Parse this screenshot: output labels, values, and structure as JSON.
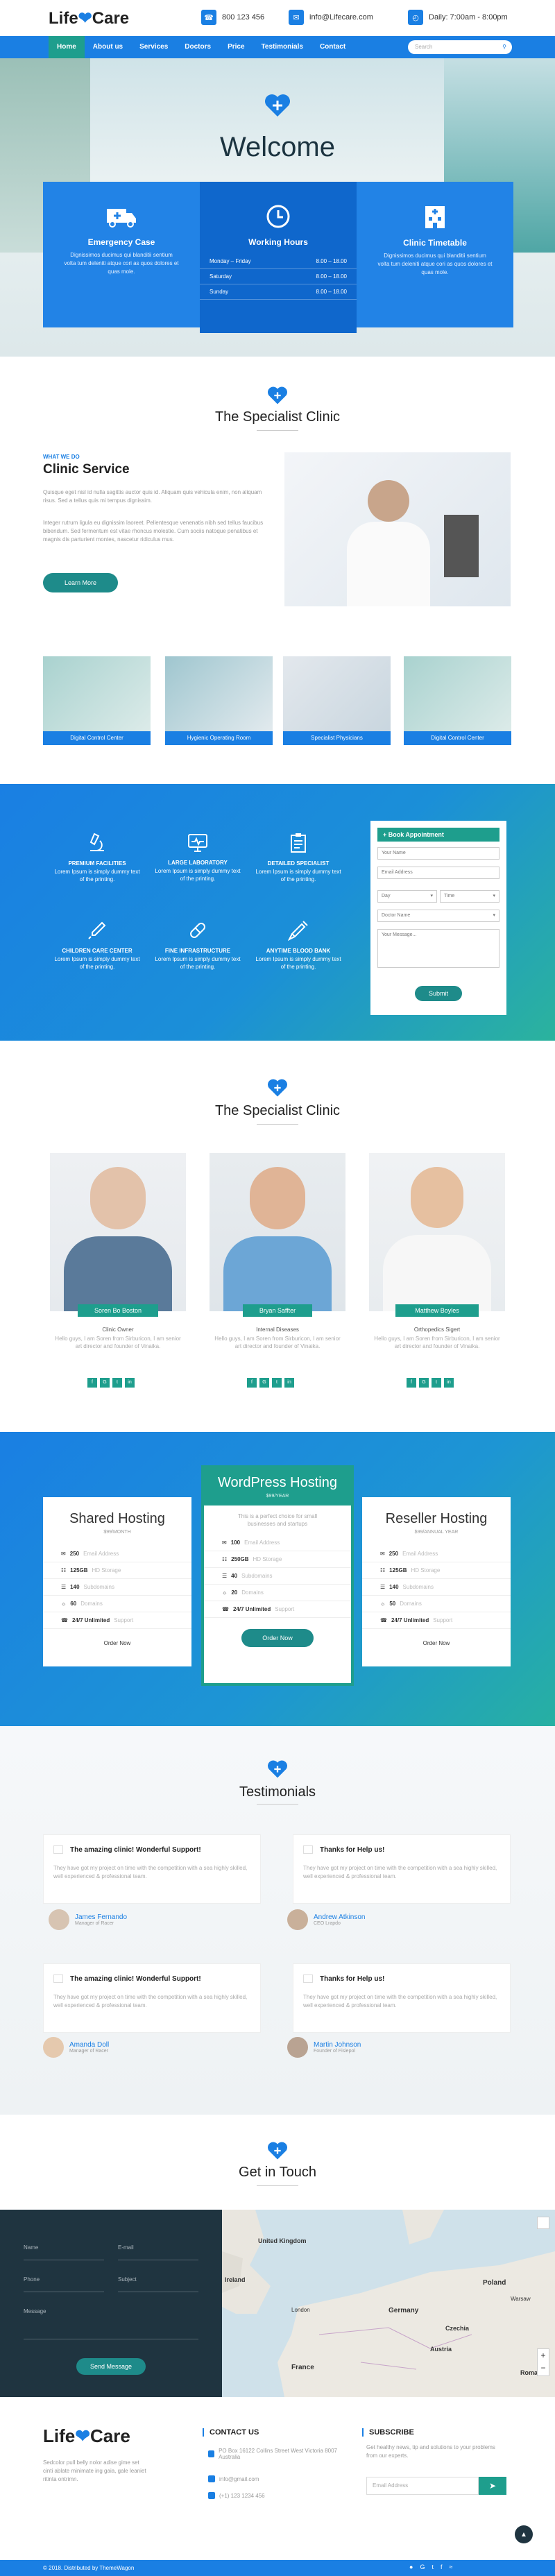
{
  "brand": {
    "logo_left": "Life",
    "logo_right": "Care",
    "primary": "#1a7fe3",
    "accent": "#1e9e8d",
    "dark": "#1f3440"
  },
  "topbar": {
    "phone": "800 123 456",
    "email": "info@Lifecare.com",
    "hours": "Daily: 7:00am - 8:00pm"
  },
  "nav": {
    "items": [
      "Home",
      "About us",
      "Services",
      "Doctors",
      "Price",
      "Testimonials",
      "Contact"
    ],
    "search_placeholder": "Search"
  },
  "hero": {
    "title": "Welcome",
    "emergency": {
      "title": "Emergency Case",
      "text": "Dignissimos ducimus qui blanditii sentium volta tum deleniti atque cori as quos dolores et quas mole."
    },
    "hours": {
      "title": "Working Hours",
      "rows": [
        {
          "day": "Monday – Friday",
          "time": "8.00 – 18.00"
        },
        {
          "day": "Saturday",
          "time": "8.00 – 18.00"
        },
        {
          "day": "Sunday",
          "time": "8.00 – 18.00"
        }
      ]
    },
    "timetable": {
      "title": "Clinic Timetable",
      "text": "Dignissimos ducimus qui blanditii sentium volta tum deleniti atque cori as quos dolores et quas mole."
    }
  },
  "specialist": {
    "title": "The Specialist Clinic",
    "what_we_do": "WHAT WE DO",
    "heading": "Clinic Service",
    "p1": "Quisque eget nisl id nulla sagittis auctor quis id. Aliquam quis vehicula enim, non aliquam risus. Sed a tellus quis mi tempus dignissim.",
    "p2": "Integer rutrum ligula eu dignissim laoreet. Pellentesque venenatis nibh sed tellus faucibus bibendum. Sed fermentum est vitae rhoncus molestie. Cum sociis natoque penatibus et magnis dis parturient montes, nascetur ridiculus mus.",
    "learn_more": "Learn More",
    "thumbs": [
      "Digital Control Center",
      "Hygienic Operating Room",
      "Specialist Physicians",
      "Digital Control Center"
    ]
  },
  "features": {
    "items": [
      {
        "title": "PREMIUM FACILITIES",
        "text": "Lorem Ipsum is simply dummy text of the printing."
      },
      {
        "title": "LARGE LABORATORY",
        "text": "Lorem Ipsum is simply dummy text of the printing."
      },
      {
        "title": "DETAILED SPECIALIST",
        "text": "Lorem Ipsum is simply dummy text of the printing."
      },
      {
        "title": "CHILDREN CARE CENTER",
        "text": "Lorem Ipsum is simply dummy text of the printing."
      },
      {
        "title": "FINE INFRASTRUCTURE",
        "text": "Lorem Ipsum is simply dummy text of the printing."
      },
      {
        "title": "ANYTIME BLOOD BANK",
        "text": "Lorem Ipsum is simply dummy text of the printing."
      }
    ],
    "appointment": {
      "header": "+ Book Appointment",
      "name": "Your Name",
      "email": "Email Address",
      "day": "Day",
      "time": "Time",
      "doctor": "Doctor Name",
      "message": "Your Message...",
      "submit": "Submit"
    }
  },
  "team": {
    "title": "The Specialist Clinic",
    "doctors": [
      {
        "name": "Soren Bo Boston",
        "role": "Clinic Owner",
        "desc": "Hello guys, I am Soren from Sirburicon, I am senior art director and founder of Vinaika."
      },
      {
        "name": "Bryan Saffter",
        "role": "Internal Diseases",
        "desc": "Hello guys, I am Soren from Sirburicon, I am senior art director and founder of Vinaika."
      },
      {
        "name": "Matthew Boyles",
        "role": "Orthopedics Sigert",
        "desc": "Hello guys, I am Soren from Sirburicon, I am senior art director and founder of Vinaika."
      }
    ]
  },
  "pricing": {
    "plans": [
      {
        "name": "Shared Hosting",
        "period": "$99/MONTH",
        "features": [
          [
            "250",
            "Email Address"
          ],
          [
            "125GB",
            "HD Storage"
          ],
          [
            "140",
            "Subdomains"
          ],
          [
            "60",
            "Domains"
          ],
          [
            "24/7 Unlimited",
            "Support"
          ]
        ],
        "cta": "Order Now"
      },
      {
        "name": "WordPress Hosting",
        "period": "$99/YEAR",
        "note": "This is a perfect choice for small businesses and startups",
        "features": [
          [
            "100",
            "Email Address"
          ],
          [
            "250GB",
            "HD Storage"
          ],
          [
            "40",
            "Subdomains"
          ],
          [
            "20",
            "Domains"
          ],
          [
            "24/7 Unlimited",
            "Support"
          ]
        ],
        "cta": "Order Now"
      },
      {
        "name": "Reseller Hosting",
        "period": "$99/ANNUAL YEAR",
        "features": [
          [
            "250",
            "Email Address"
          ],
          [
            "125GB",
            "HD Storage"
          ],
          [
            "140",
            "Subdomains"
          ],
          [
            "50",
            "Domains"
          ],
          [
            "24/7 Unlimited",
            "Support"
          ]
        ],
        "cta": "Order Now"
      }
    ]
  },
  "testimonials": {
    "title": "Testimonials",
    "items": [
      {
        "title": "The amazing clinic! Wonderful Support!",
        "text": "They have got my project on time with the competition with a sea highly skilled, well experienced & professional team.",
        "name": "James Fernando",
        "role": "Manager of Racer"
      },
      {
        "title": "Thanks for Help us!",
        "text": "They have got my project on time with the competition with a sea highly skilled, well experienced & professional team.",
        "name": "Andrew Atkinson",
        "role": "CEO Lrapdo"
      },
      {
        "title": "The amazing clinic! Wonderful Support!",
        "text": "They have got my project on time with the competition with a sea highly skilled, well experienced & professional team.",
        "name": "Amanda Doll",
        "role": "Manager of Racer"
      },
      {
        "title": "Thanks for Help us!",
        "text": "They have got my project on time with the competition with a sea highly skilled, well experienced & professional team.",
        "name": "Martin Johnson",
        "role": "Founder of Fisiepol"
      }
    ]
  },
  "contact": {
    "title": "Get in Touch",
    "name": "Name",
    "email": "E-mail",
    "phone": "Phone",
    "subject": "Subject",
    "message": "Message",
    "send": "Send Message",
    "map_labels": [
      "United Kingdom",
      "Ireland",
      "Poland",
      "Germany",
      "Czechia",
      "Austria",
      "France",
      "Romania",
      "London",
      "Warsaw"
    ]
  },
  "footer": {
    "about": "Sedcolor pull belly nolor adise gime set cinti ablate minimate ing gaia, gale leaniet ritinta ontrimn.",
    "contact_title": "CONTACT US",
    "address": "PO Box 16122 Collins Street West Victoria 8007 Australia",
    "email": "info@gmail.com",
    "phone": "(+1) 123 1234 456",
    "subscribe_title": "SUBSCRIBE",
    "subscribe_text": "Get healthy news, tip and solutions to your problems from our experts.",
    "email_placeholder": "Email Address",
    "copyright": "© 2018. Distributed by ThemeWagon"
  }
}
